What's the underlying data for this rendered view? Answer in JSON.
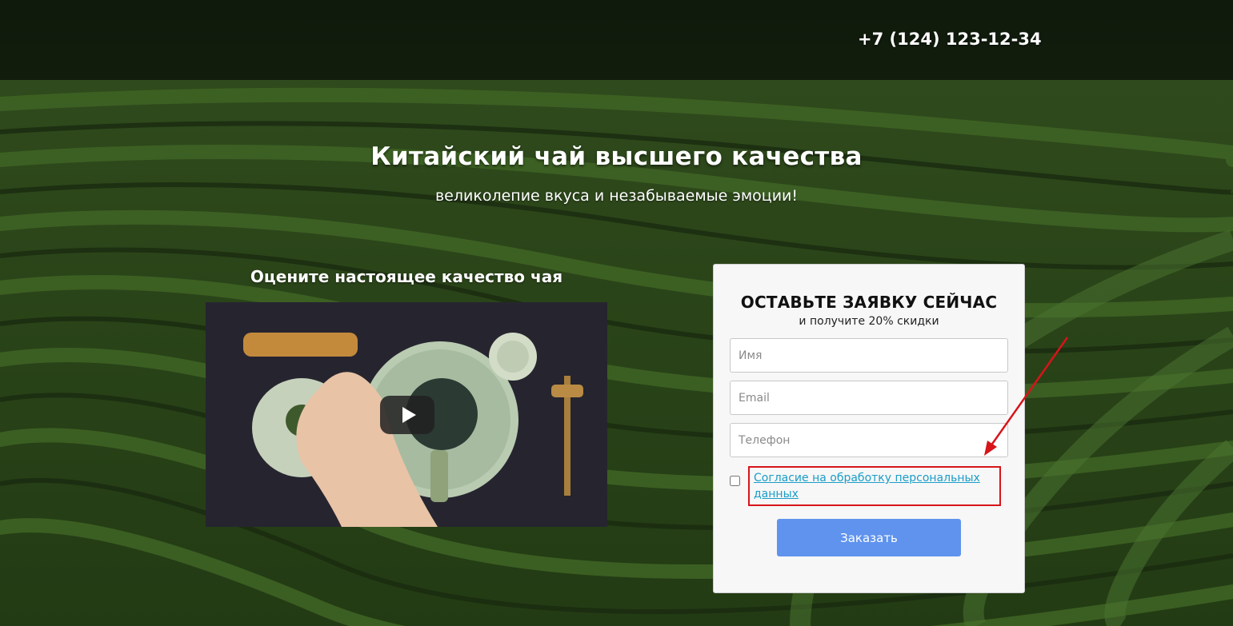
{
  "header": {
    "phone": "+7 (124) 123-12-34"
  },
  "hero": {
    "title": "Китайский чай высшего качества",
    "subtitle": "великолепие вкуса и незабываемые эмоции!"
  },
  "video": {
    "title": "Оцените настоящее качество чая"
  },
  "form": {
    "title": "ОСТАВЬТЕ ЗАЯВКУ СЕЙЧАС",
    "subtitle": "и получите 20% скидки",
    "name_placeholder": "Имя",
    "email_placeholder": "Email",
    "phone_placeholder": "Телефон",
    "consent_text": "Согласие на обработку персональных данных",
    "submit_label": "Заказать"
  },
  "colors": {
    "button": "#5f93ee",
    "link": "#1a9dc8",
    "highlight": "#d7141a"
  }
}
